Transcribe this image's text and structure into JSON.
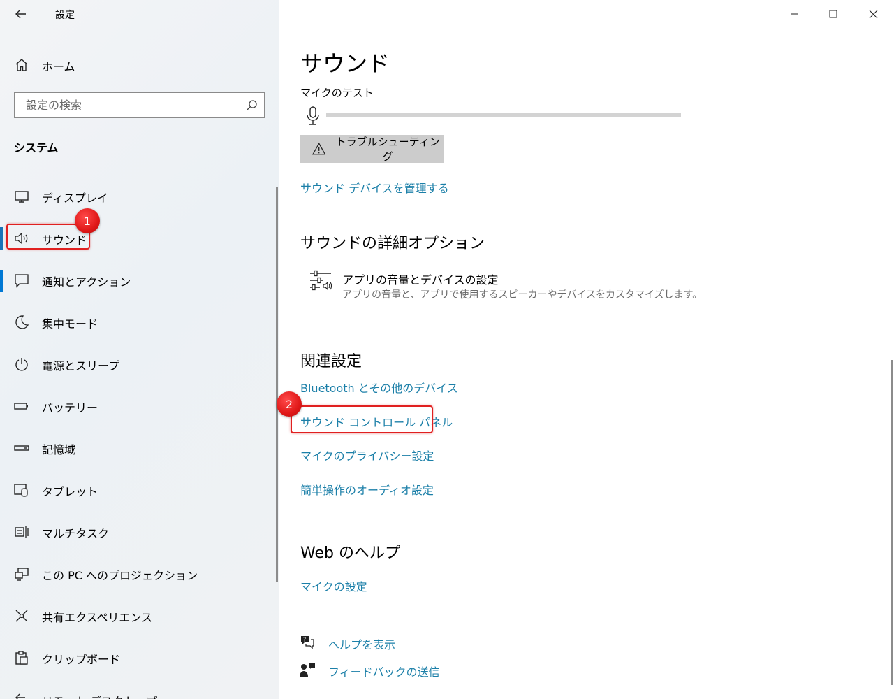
{
  "window": {
    "app_title": "設定",
    "minimize_icon": "minimize-icon",
    "maximize_icon": "maximize-icon",
    "close_icon": "close-icon"
  },
  "sidebar": {
    "home_label": "ホーム",
    "search": {
      "placeholder": "設定の検索",
      "value": ""
    },
    "section_title": "システム",
    "items": [
      {
        "label": "ディスプレイ",
        "icon": "monitor-icon"
      },
      {
        "label": "サウンド",
        "icon": "speaker-icon",
        "active": true
      },
      {
        "label": "通知とアクション",
        "icon": "notification-icon"
      },
      {
        "label": "集中モード",
        "icon": "moon-icon"
      },
      {
        "label": "電源とスリープ",
        "icon": "power-icon"
      },
      {
        "label": "バッテリー",
        "icon": "battery-icon"
      },
      {
        "label": "記憶域",
        "icon": "storage-icon"
      },
      {
        "label": "タブレット",
        "icon": "tablet-icon"
      },
      {
        "label": "マルチタスク",
        "icon": "multitask-icon"
      },
      {
        "label": "この PC へのプロジェクション",
        "icon": "projection-icon"
      },
      {
        "label": "共有エクスペリエンス",
        "icon": "share-icon"
      },
      {
        "label": "クリップボード",
        "icon": "clipboard-icon"
      },
      {
        "label": "リモート デスクトップ",
        "icon": "remote-desktop-icon"
      }
    ]
  },
  "annotations": {
    "badge1": "1",
    "badge2": "2",
    "highlight_color": "#e02020"
  },
  "main": {
    "title": "サウンド",
    "mic_test_label": "マイクのテスト",
    "mic_level": 0,
    "troubleshoot_label": "トラブルシューティング",
    "manage_devices_link": "サウンド デバイスを管理する",
    "advanced_heading": "サウンドの詳細オプション",
    "app_volume": {
      "title": "アプリの音量とデバイスの設定",
      "description": "アプリの音量と、アプリで使用するスピーカーやデバイスをカスタマイズします。"
    },
    "related_heading": "関連設定",
    "related_links": [
      "Bluetooth とその他のデバイス",
      "サウンド コントロール パネル",
      "マイクのプライバシー設定",
      "簡単操作のオーディオ設定"
    ],
    "web_help_heading": "Web のヘルプ",
    "web_help_link": "マイクの設定",
    "help_label": "ヘルプを表示",
    "feedback_label": "フィードバックの送信"
  },
  "colors": {
    "accent": "#0078d4",
    "link": "#1b7fa8"
  }
}
